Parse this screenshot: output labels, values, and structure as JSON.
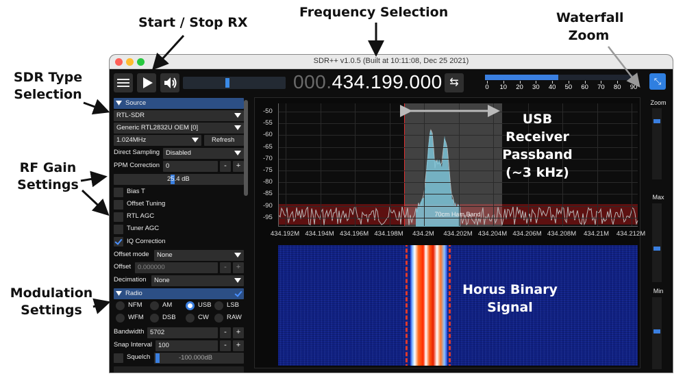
{
  "annotations": {
    "start_stop": "Start / Stop RX",
    "frequency_selection": "Frequency Selection",
    "waterfall_zoom_1": "Waterfall",
    "waterfall_zoom_2": "Zoom",
    "sdr_type_1": "SDR Type",
    "sdr_type_2": "Selection",
    "rf_gain_1": "RF Gain",
    "rf_gain_2": "Settings",
    "modulation_1": "Modulation",
    "modulation_2": "Settings",
    "usb_1": "USB",
    "usb_2": "Receiver",
    "usb_3": "Passband",
    "usb_4": "(~3 kHz)",
    "horus_1": "Horus Binary",
    "horus_2": "Signal"
  },
  "window": {
    "title": "SDR++ v1.0.5 (Built at 10:11:08, Dec 25 2021)"
  },
  "toolbar": {
    "freq_dim": "000.",
    "freq_main": "434.199.000",
    "swap_symbol": "⇆",
    "zoom_tool_symbol": "⤡",
    "meter_ticks": [
      "0",
      "10",
      "20",
      "30",
      "40",
      "50",
      "60",
      "70",
      "80",
      "90"
    ],
    "meter_level": 0.48
  },
  "colors": {
    "accent": "#3a7fe0",
    "header": "#2c4f85",
    "ham_band": "#a01414",
    "signal_hot": "#ff2a00"
  },
  "source": {
    "header": "Source",
    "sdr_type": "RTL-SDR",
    "device": "Generic RTL2832U OEM [0]",
    "sample_rate": "1.024MHz",
    "refresh": "Refresh",
    "direct_sampling_label": "Direct Sampling",
    "direct_sampling_value": "Disabled",
    "ppm_label": "PPM Correction",
    "ppm_value": "0",
    "minus": "-",
    "plus": "+",
    "gain_value": "25.4 dB",
    "gain_level": 0.45,
    "bias_t": "Bias T",
    "offset_tuning": "Offset Tuning",
    "rtl_agc": "RTL AGC",
    "tuner_agc": "Tuner AGC",
    "iq_correction": "IQ Correction",
    "offset_mode_label": "Offset mode",
    "offset_mode_value": "None",
    "offset_label": "Offset",
    "offset_value": "0.000000",
    "decimation_label": "Decimation",
    "decimation_value": "None"
  },
  "radio": {
    "header": "Radio",
    "modes": [
      "NFM",
      "AM",
      "USB",
      "LSB",
      "WFM",
      "DSB",
      "CW",
      "RAW"
    ],
    "selected": "USB",
    "bandwidth_label": "Bandwidth",
    "bandwidth_value": "5702",
    "snap_label": "Snap Interval",
    "snap_value": "100",
    "squelch_label": "Squelch",
    "squelch_value": "-100.000dB"
  },
  "fft": {
    "y_ticks": [
      "-50",
      "-55",
      "-60",
      "-65",
      "-70",
      "-75",
      "-80",
      "-85",
      "-90",
      "-95"
    ],
    "x_ticks": [
      "434.192M",
      "434.194M",
      "434.196M",
      "434.198M",
      "434.2M",
      "434.202M",
      "434.204M",
      "434.206M",
      "434.208M",
      "434.21M",
      "434.212M"
    ],
    "band_label": "70cm Ham Band"
  },
  "zoom": {
    "zoom_label": "Zoom",
    "max_label": "Max",
    "min_label": "Min",
    "zoom_level": 0.15,
    "max_level": 0.55,
    "min_level": 0.45
  }
}
